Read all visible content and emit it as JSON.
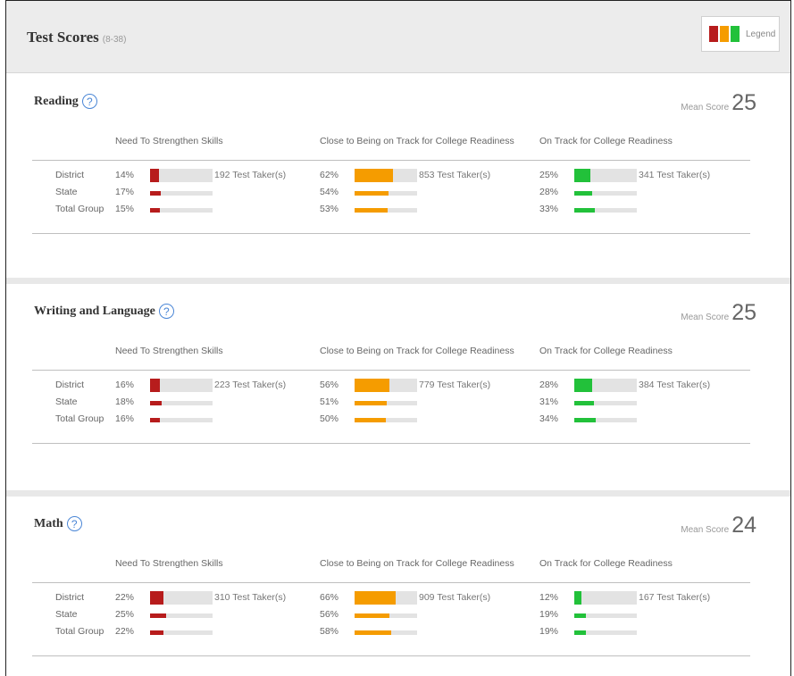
{
  "header": {
    "title": "Test Scores",
    "range": "(8-38)",
    "legend_label": "Legend"
  },
  "colors": {
    "red": "#b71c1c",
    "orange": "#f59c00",
    "green": "#22c13a",
    "track": "#e3e3e3"
  },
  "column_headers": [
    "Need To Strengthen Skills",
    "Close to Being on Track for College Readiness",
    "On Track for College Readiness"
  ],
  "row_labels": [
    "District",
    "State",
    "Total Group"
  ],
  "sections": [
    {
      "title": "Reading",
      "mean_label": "Mean Score",
      "mean_score": "25",
      "columns": [
        {
          "district": "14%",
          "state": "17%",
          "total": "15%",
          "district_val": 14,
          "state_val": 17,
          "total_val": 15,
          "takers": "192 Test Taker(s)"
        },
        {
          "district": "62%",
          "state": "54%",
          "total": "53%",
          "district_val": 62,
          "state_val": 54,
          "total_val": 53,
          "takers": "853 Test Taker(s)"
        },
        {
          "district": "25%",
          "state": "28%",
          "total": "33%",
          "district_val": 25,
          "state_val": 28,
          "total_val": 33,
          "takers": "341 Test Taker(s)"
        }
      ]
    },
    {
      "title": "Writing and Language",
      "mean_label": "Mean Score",
      "mean_score": "25",
      "columns": [
        {
          "district": "16%",
          "state": "18%",
          "total": "16%",
          "district_val": 16,
          "state_val": 18,
          "total_val": 16,
          "takers": "223 Test Taker(s)"
        },
        {
          "district": "56%",
          "state": "51%",
          "total": "50%",
          "district_val": 56,
          "state_val": 51,
          "total_val": 50,
          "takers": "779 Test Taker(s)"
        },
        {
          "district": "28%",
          "state": "31%",
          "total": "34%",
          "district_val": 28,
          "state_val": 31,
          "total_val": 34,
          "takers": "384 Test Taker(s)"
        }
      ]
    },
    {
      "title": "Math",
      "mean_label": "Mean Score",
      "mean_score": "24",
      "columns": [
        {
          "district": "22%",
          "state": "25%",
          "total": "22%",
          "district_val": 22,
          "state_val": 25,
          "total_val": 22,
          "takers": "310 Test Taker(s)"
        },
        {
          "district": "66%",
          "state": "56%",
          "total": "58%",
          "district_val": 66,
          "state_val": 56,
          "total_val": 58,
          "takers": "909 Test Taker(s)"
        },
        {
          "district": "12%",
          "state": "19%",
          "total": "19%",
          "district_val": 12,
          "state_val": 19,
          "total_val": 19,
          "takers": "167 Test Taker(s)"
        }
      ]
    }
  ]
}
